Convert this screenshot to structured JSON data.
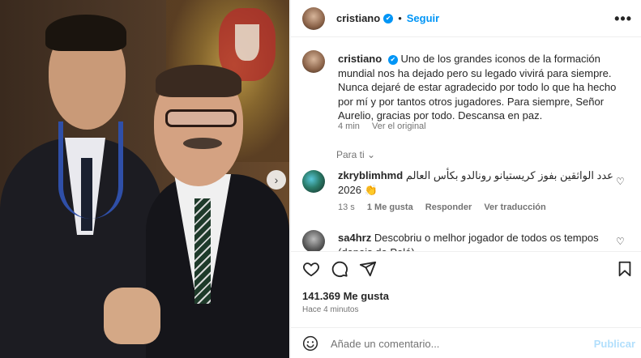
{
  "header": {
    "username": "cristiano",
    "dot": "•",
    "follow_label": "Seguir",
    "more_label": "•••"
  },
  "caption": {
    "username": "cristiano",
    "text": "Uno de los grandes iconos de la formación mundial nos ha dejado pero su legado vivirá para siempre. Nunca dejaré de estar agradecido por todo lo que ha hecho por mí y por tantos otros jugadores. Para siempre, Señor Aurelio, gracias por todo. Descansa en paz.",
    "time": "4 min",
    "see_original": "Ver el original"
  },
  "for_you": "Para ti",
  "comments": [
    {
      "username": "zkryblimhmd",
      "text": "عدد الواثقين بفوز كريستيانو رونالدو بكأس العالم 2026",
      "emoji": "👏",
      "time": "13 s",
      "likes": "1 Me gusta",
      "reply": "Responder",
      "translate": "Ver traducción"
    },
    {
      "username": "sa4hrz",
      "text": "Descobriu o melhor jogador de todos os tempos (depois de Pelé)"
    }
  ],
  "actions": {
    "likes": "141.369 Me gusta",
    "posted": "Hace 4 minutos"
  },
  "comment_box": {
    "placeholder": "Añade un comentario...",
    "publish_label": "Publicar"
  },
  "icons": {
    "verified": "verified-badge-icon",
    "like": "heart-icon",
    "comment": "comment-icon",
    "share": "send-icon",
    "save": "bookmark-icon",
    "emoji": "emoji-icon",
    "next": "chevron-right-icon"
  },
  "colors": {
    "accent": "#0095f6",
    "text": "#262626",
    "muted": "#737373",
    "publish_disabled": "#b2dffc"
  }
}
